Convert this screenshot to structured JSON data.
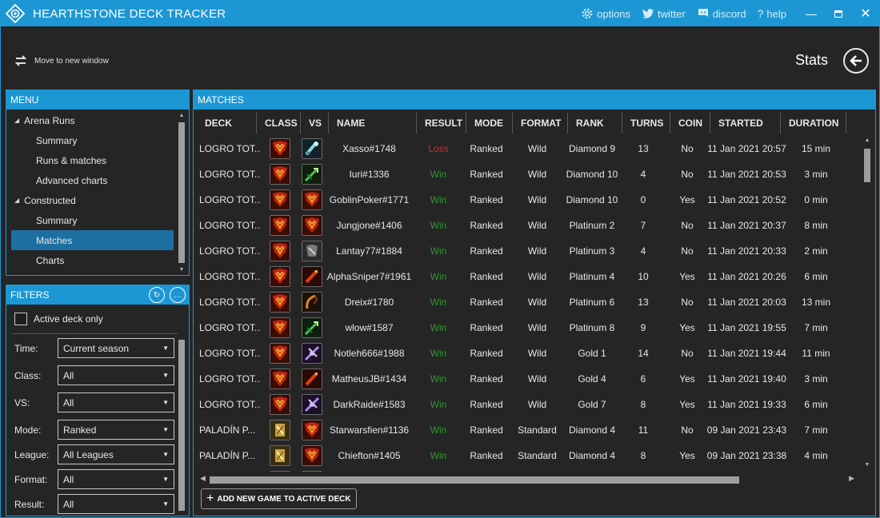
{
  "window": {
    "title": "HEARTHSTONE DECK TRACKER",
    "links": {
      "options": "options",
      "twitter": "twitter",
      "discord": "discord",
      "help": "help"
    },
    "accent": "#1c97d4"
  },
  "topbar": {
    "move_label": "Move to new window",
    "page_title": "Stats"
  },
  "menu": {
    "header": "MENU",
    "items": [
      {
        "label": "Arena Runs",
        "type": "group"
      },
      {
        "label": "Summary",
        "type": "sub"
      },
      {
        "label": "Runs & matches",
        "type": "sub"
      },
      {
        "label": "Advanced charts",
        "type": "sub"
      },
      {
        "label": "Constructed",
        "type": "group"
      },
      {
        "label": "Summary",
        "type": "sub"
      },
      {
        "label": "Matches",
        "type": "sub",
        "selected": true
      },
      {
        "label": "Charts",
        "type": "sub"
      }
    ]
  },
  "filters": {
    "header": "FILTERS",
    "active_deck_only": "Active deck only",
    "rows": [
      {
        "label": "Time:",
        "value": "Current season"
      },
      {
        "label": "Class:",
        "value": "All"
      },
      {
        "label": "VS:",
        "value": "All"
      },
      {
        "label": "Mode:",
        "value": "Ranked"
      },
      {
        "label": "League:",
        "value": "All Leagues"
      },
      {
        "label": "Format:",
        "value": "All"
      },
      {
        "label": "Result:",
        "value": "All"
      }
    ]
  },
  "matches": {
    "header": "MATCHES",
    "columns": [
      "DECK",
      "CLASS",
      "VS",
      "NAME",
      "RESULT",
      "MODE",
      "FORMAT",
      "RANK",
      "TURNS",
      "COIN",
      "STARTED",
      "DURATION"
    ],
    "rows": [
      {
        "deck": "LOGRO TOT...",
        "class_icon": "shaman-icon",
        "vs_icon": "mage-icon",
        "name": "Xasso#1748",
        "result": "Loss",
        "mode": "Ranked",
        "format": "Wild",
        "rank": "Diamond 9",
        "turns": "13",
        "coin": "No",
        "started": "11 Jan 2021 20:57",
        "duration": "15 min"
      },
      {
        "deck": "LOGRO TOT...",
        "class_icon": "shaman-icon",
        "vs_icon": "hunter-icon",
        "name": "Iuri#1336",
        "result": "Win",
        "mode": "Ranked",
        "format": "Wild",
        "rank": "Diamond 10",
        "turns": "4",
        "coin": "No",
        "started": "11 Jan 2021 20:53",
        "duration": "3 min"
      },
      {
        "deck": "LOGRO TOT...",
        "class_icon": "shaman-icon",
        "vs_icon": "shaman-icon",
        "name": "GoblinPoker#1771",
        "result": "Win",
        "mode": "Ranked",
        "format": "Wild",
        "rank": "Diamond 10",
        "turns": "0",
        "coin": "Yes",
        "started": "11 Jan 2021 20:52",
        "duration": "0 min"
      },
      {
        "deck": "LOGRO TOT...",
        "class_icon": "shaman-icon",
        "vs_icon": "shaman-icon",
        "name": "Jungjone#1406",
        "result": "Win",
        "mode": "Ranked",
        "format": "Wild",
        "rank": "Platinum 2",
        "turns": "7",
        "coin": "No",
        "started": "11 Jan 2021 20:37",
        "duration": "8 min"
      },
      {
        "deck": "LOGRO TOT...",
        "class_icon": "shaman-icon",
        "vs_icon": "warrior-icon",
        "name": "Lantay77#1884",
        "result": "Win",
        "mode": "Ranked",
        "format": "Wild",
        "rank": "Platinum 3",
        "turns": "4",
        "coin": "No",
        "started": "11 Jan 2021 20:33",
        "duration": "2 min"
      },
      {
        "deck": "LOGRO TOT...",
        "class_icon": "shaman-icon",
        "vs_icon": "rogue-icon",
        "name": "AlphaSniper7#1961",
        "result": "Win",
        "mode": "Ranked",
        "format": "Wild",
        "rank": "Platinum 4",
        "turns": "10",
        "coin": "Yes",
        "started": "11 Jan 2021 20:26",
        "duration": "6 min"
      },
      {
        "deck": "LOGRO TOT...",
        "class_icon": "shaman-icon",
        "vs_icon": "druid-icon",
        "name": "Dreix#1780",
        "result": "Win",
        "mode": "Ranked",
        "format": "Wild",
        "rank": "Platinum 6",
        "turns": "13",
        "coin": "No",
        "started": "11 Jan 2021 20:03",
        "duration": "13 min"
      },
      {
        "deck": "LOGRO TOT...",
        "class_icon": "shaman-icon",
        "vs_icon": "hunter-icon",
        "name": "wlow#1587",
        "result": "Win",
        "mode": "Ranked",
        "format": "Wild",
        "rank": "Platinum 8",
        "turns": "9",
        "coin": "Yes",
        "started": "11 Jan 2021 19:55",
        "duration": "7 min"
      },
      {
        "deck": "LOGRO TOT...",
        "class_icon": "shaman-icon",
        "vs_icon": "priest-icon",
        "name": "Notleh666#1988",
        "result": "Win",
        "mode": "Ranked",
        "format": "Wild",
        "rank": "Gold 1",
        "turns": "14",
        "coin": "No",
        "started": "11 Jan 2021 19:44",
        "duration": "11 min"
      },
      {
        "deck": "LOGRO TOT...",
        "class_icon": "shaman-icon",
        "vs_icon": "rogue-icon",
        "name": "MatheusJB#1434",
        "result": "Win",
        "mode": "Ranked",
        "format": "Wild",
        "rank": "Gold 4",
        "turns": "6",
        "coin": "Yes",
        "started": "11 Jan 2021 19:40",
        "duration": "3 min"
      },
      {
        "deck": "LOGRO TOT...",
        "class_icon": "shaman-icon",
        "vs_icon": "priest-icon",
        "name": "DarkRaide#1583",
        "result": "Win",
        "mode": "Ranked",
        "format": "Wild",
        "rank": "Gold 7",
        "turns": "8",
        "coin": "Yes",
        "started": "11 Jan 2021 19:33",
        "duration": "6 min"
      },
      {
        "deck": "PALADÍN P...",
        "class_icon": "paladin-icon",
        "vs_icon": "shaman-icon",
        "name": "Starwarsfien#1136",
        "result": "Win",
        "mode": "Ranked",
        "format": "Standard",
        "rank": "Diamond 4",
        "turns": "11",
        "coin": "No",
        "started": "09 Jan 2021 23:43",
        "duration": "7 min"
      },
      {
        "deck": "PALADÍN P...",
        "class_icon": "paladin-icon",
        "vs_icon": "shaman-icon",
        "name": "Chiefton#1405",
        "result": "Win",
        "mode": "Ranked",
        "format": "Standard",
        "rank": "Diamond 4",
        "turns": "8",
        "coin": "Yes",
        "started": "09 Jan 2021 23:38",
        "duration": "4 min"
      },
      {
        "deck": "",
        "class_icon": "paladin-icon",
        "vs_icon": "paladin-icon",
        "name": "",
        "result": "",
        "mode": "",
        "format": "",
        "rank": "",
        "turns": "",
        "coin": "",
        "started": "",
        "duration": ""
      }
    ],
    "add_button": "ADD NEW GAME TO ACTIVE DECK"
  }
}
